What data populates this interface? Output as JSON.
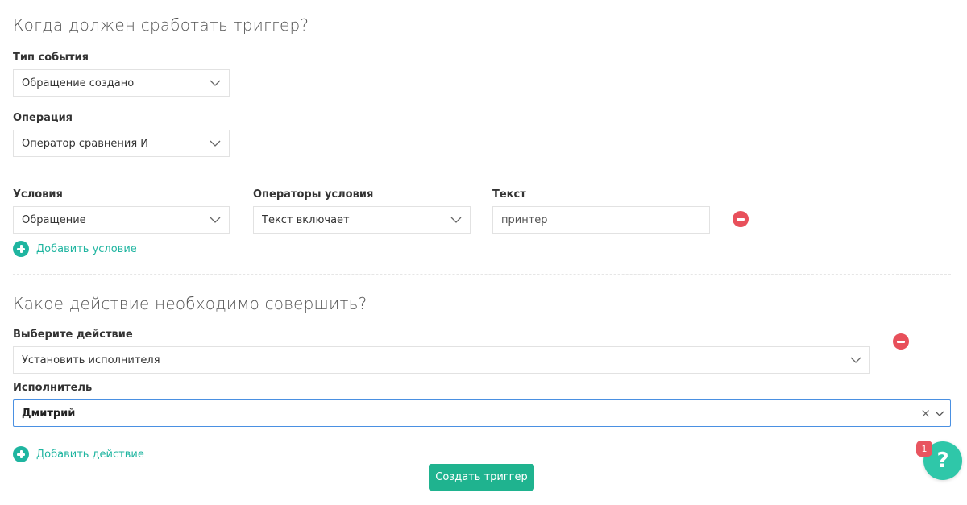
{
  "trigger_section": {
    "heading": "Когда должен сработать триггер?",
    "event_type": {
      "label": "Тип события",
      "value": "Обращение создано"
    },
    "operation": {
      "label": "Операция",
      "value": "Оператор сравнения И"
    },
    "conditions": {
      "header_condition": "Условия",
      "header_operator": "Операторы условия",
      "header_text": "Текст",
      "row": {
        "condition": "Обращение",
        "operator": "Текст включает",
        "text": "принтер"
      },
      "add_label": "Добавить условие"
    }
  },
  "action_section": {
    "heading": "Какое действие необходимо совершить?",
    "action": {
      "label": "Выберите действие",
      "value": "Установить исполнителя"
    },
    "assignee": {
      "label": "Исполнитель",
      "value": "Дмитрий",
      "clear_glyph": "×"
    },
    "add_label": "Добавить действие"
  },
  "submit_label": "Создать триггер",
  "help": {
    "glyph": "?",
    "badge": "1"
  },
  "icons": {
    "chevron": "chevron-down-icon",
    "remove": "minus-circle-icon",
    "add": "plus-circle-icon",
    "clear": "close-icon",
    "help": "question-icon"
  },
  "colors": {
    "accent": "#1fb5a0",
    "primary_button": "#1fb38f",
    "remove": "#e8505b",
    "focus_border": "#4a90e2",
    "help_button": "#2fc7a9",
    "badge": "#e85560"
  }
}
